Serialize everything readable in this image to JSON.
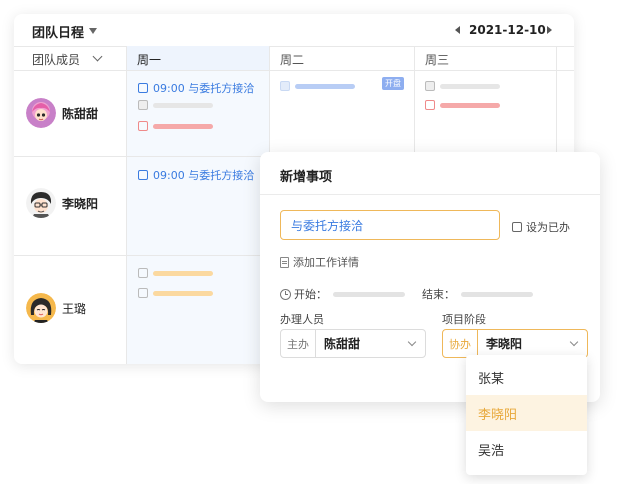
{
  "calendar": {
    "title": "团队日程",
    "date": "2021-12-10",
    "member_header": "团队成员",
    "days": [
      "周一",
      "周二",
      "周三"
    ],
    "members": [
      {
        "name": "陈甜甜",
        "avatar": "girl-pink-hair-avatar"
      },
      {
        "name": "李晓阳",
        "avatar": "boy-glasses-avatar"
      },
      {
        "name": "王璐",
        "avatar": "girl-black-hair-avatar"
      }
    ],
    "tasks": {
      "row1_mon": "09:00 与委托方接洽",
      "row2_mon": "09:00 与委托方接洽"
    },
    "badge": "开盘"
  },
  "popup": {
    "title": "新增事项",
    "task_value": "与委托方接洽",
    "mark_done": "设为已办",
    "add_detail": "添加工作详情",
    "start_label": "开始：",
    "end_label": "结束：",
    "handler_label": "办理人员",
    "stage_label": "项目阶段",
    "main_prefix": "主办",
    "main_value": "陈甜甜",
    "assist_prefix": "协办",
    "assist_value": "李晓阳"
  },
  "dropdown": {
    "options": [
      "张某",
      "李晓阳",
      "吴浩"
    ],
    "selected": "李晓阳"
  },
  "colors": {
    "accent_blue": "#3a7be0",
    "accent_orange": "#e8a83a",
    "bar_red": "#f5a9a9",
    "bar_orange": "#fbd9a0",
    "bar_blue": "#b8cdf5"
  }
}
